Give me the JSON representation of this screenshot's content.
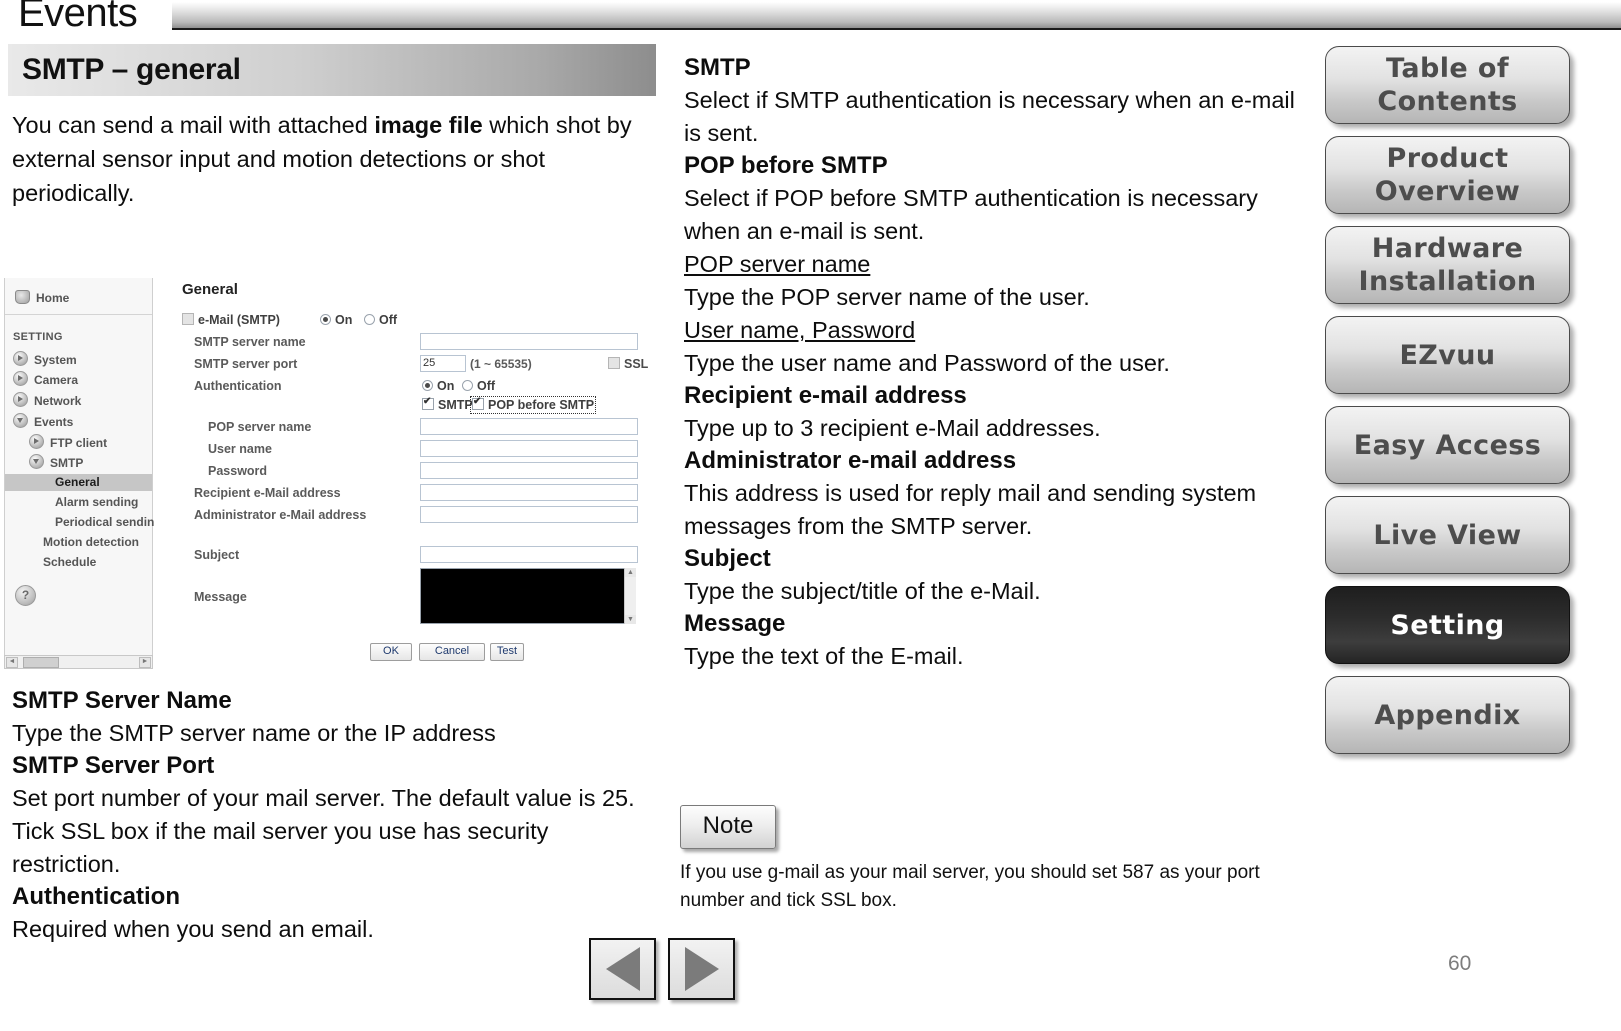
{
  "header": {
    "title": "Events"
  },
  "section": {
    "title": "SMTP – general"
  },
  "intro": {
    "part1": "You can send a mail with attached ",
    "bold": "image file",
    "part2": " which shot by external sensor input and motion detections or shot periodically."
  },
  "app_screenshot": {
    "sidebar": {
      "home": "Home",
      "group_label": "SETTING",
      "items": [
        {
          "label": "System"
        },
        {
          "label": "Camera"
        },
        {
          "label": "Network"
        },
        {
          "label": "Events"
        },
        {
          "label": "FTP client"
        },
        {
          "label": "SMTP"
        },
        {
          "label": "General"
        },
        {
          "label": "Alarm sending"
        },
        {
          "label": "Periodical sendin"
        },
        {
          "label": "Motion detection"
        },
        {
          "label": "Schedule"
        }
      ],
      "help_glyph": "?"
    },
    "form": {
      "title": "General",
      "email_smtp_label": "e-Mail (SMTP)",
      "on_label": "On",
      "off_label": "Off",
      "smtp_server_name_label": "SMTP server name",
      "smtp_server_port_label": "SMTP server port",
      "smtp_server_port_value": "25",
      "port_range_hint": "(1 ~ 65535)",
      "ssl_label": "SSL",
      "authentication_label": "Authentication",
      "auth_on_label": "On",
      "auth_off_label": "Off",
      "smtp_checkbox_label": "SMTP",
      "pop_before_smtp_checkbox_label": "POP before SMTP",
      "pop_server_name_label": "POP server name",
      "user_name_label": "User name",
      "password_label": "Password",
      "recipient_label": "Recipient e-Mail address",
      "administrator_label": "Administrator e-Mail address",
      "subject_label": "Subject",
      "message_label": "Message",
      "buttons": [
        {
          "label": "OK"
        },
        {
          "label": "Cancel"
        },
        {
          "label": "Test"
        }
      ]
    }
  },
  "left_copy": [
    {
      "type": "h",
      "text": "SMTP Server Name"
    },
    {
      "type": "p",
      "text": "Type the SMTP server name or the IP address"
    },
    {
      "type": "h",
      "text": "SMTP Server Port"
    },
    {
      "type": "p",
      "text": "Set port number of your mail server. The default value is 25. Tick SSL box if the mail server you use has security restriction."
    },
    {
      "type": "h",
      "text": "Authentication"
    },
    {
      "type": "p",
      "text": "Required when you send an email."
    }
  ],
  "mid_copy": [
    {
      "type": "h",
      "text": "SMTP"
    },
    {
      "type": "p",
      "text": "Select if SMTP authentication is necessary when an e-mail is sent."
    },
    {
      "type": "h",
      "text": "POP before SMTP"
    },
    {
      "type": "p",
      "text": "Select if POP before SMTP authentication is necessary when an e-mail is sent."
    },
    {
      "type": "u",
      "text": "POP server name"
    },
    {
      "type": "p",
      "text": "Type the POP server name of the user."
    },
    {
      "type": "u",
      "text": "User name, Password"
    },
    {
      "type": "p",
      "text": "Type the user name and Password of the user."
    },
    {
      "type": "h",
      "text": "Recipient e-mail address"
    },
    {
      "type": "p",
      "text": "Type up to 3 recipient e-Mail addresses."
    },
    {
      "type": "h",
      "text": "Administrator e-mail address"
    },
    {
      "type": "p",
      "text": "This address is used for reply mail and sending system messages from the SMTP server."
    },
    {
      "type": "h",
      "text": "Subject"
    },
    {
      "type": "p",
      "text": "Type the subject/title of the e-Mail."
    },
    {
      "type": "h",
      "text": "Message"
    },
    {
      "type": "p",
      "text": "Type the text of the E-mail."
    }
  ],
  "note": {
    "label": "Note",
    "text": "If you use g-mail as your mail server, you should set 587 as your port number and tick SSL box."
  },
  "right_nav": {
    "items": [
      {
        "label": "Table of Contents",
        "active": false
      },
      {
        "label": "Product Overview",
        "active": false
      },
      {
        "label": "Hardware Installation",
        "active": false
      },
      {
        "label": "EZvuu",
        "active": false
      },
      {
        "label": "Easy Access",
        "active": false
      },
      {
        "label": "Live View",
        "active": false
      },
      {
        "label": "Setting",
        "active": true
      },
      {
        "label": "Appendix",
        "active": false
      }
    ]
  },
  "footer": {
    "prev_label": "previous-page",
    "next_label": "next-page",
    "page_number": "60"
  }
}
